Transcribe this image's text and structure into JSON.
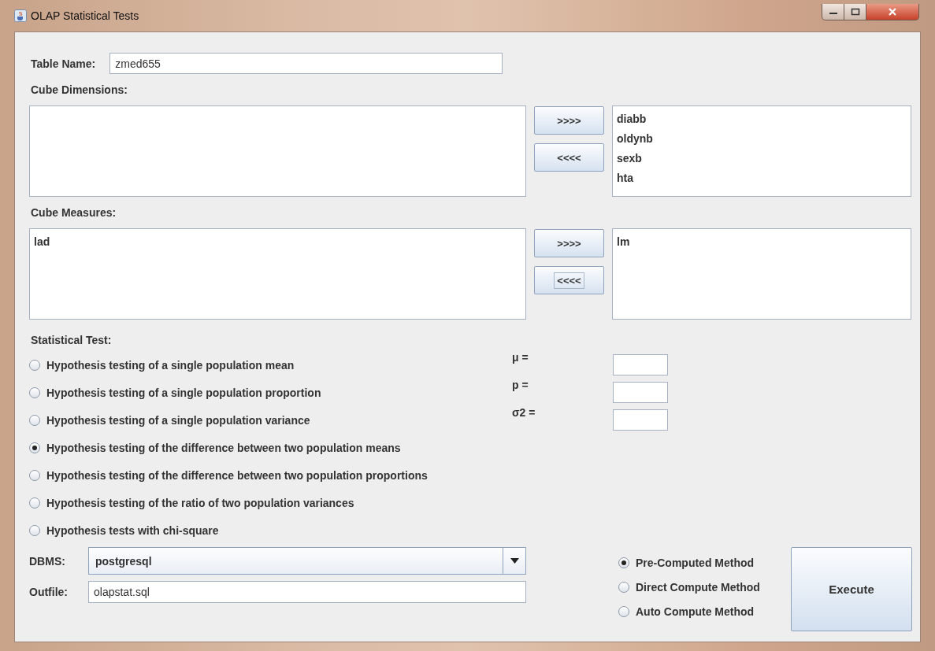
{
  "window": {
    "title": "OLAP Statistical Tests"
  },
  "table_name": {
    "label": "Table Name:",
    "value": "zmed655"
  },
  "cube_dimensions": {
    "label": "Cube Dimensions:",
    "buttons": [
      {
        "label": ">>>>",
        "focused": false
      },
      {
        "label": "<<<<",
        "focused": false
      }
    ],
    "chosen": [
      "diabb",
      "oldynb",
      "sexb",
      "hta"
    ]
  },
  "cube_measures": {
    "label": "Cube Measures:",
    "available": [
      "lad"
    ],
    "buttons": [
      {
        "label": ">>>>",
        "focused": false
      },
      {
        "label": "<<<<",
        "focused": true
      }
    ],
    "chosen": [
      "lm"
    ]
  },
  "statistical_test": {
    "label": "Statistical Test:",
    "options": [
      {
        "label": "Hypothesis testing of a single population mean",
        "selected": false
      },
      {
        "label": "Hypothesis testing of a single population proportion",
        "selected": false
      },
      {
        "label": "Hypothesis testing of a single population variance",
        "selected": false
      },
      {
        "label": "Hypothesis testing of the difference between two population means",
        "selected": true
      },
      {
        "label": "Hypothesis testing of the difference between two population proportions",
        "selected": false
      },
      {
        "label": "Hypothesis testing of the ratio of two population variances",
        "selected": false
      },
      {
        "label": "Hypothesis tests with chi-square",
        "selected": false
      }
    ],
    "parameters": [
      {
        "label": "μ ="
      },
      {
        "label": "p ="
      },
      {
        "label": "σ2 ="
      }
    ]
  },
  "dbms": {
    "label": "DBMS:",
    "value": "postgresql"
  },
  "outfile": {
    "label": "Outfile:",
    "value": "olapstat.sql"
  },
  "methods": [
    {
      "label": "Pre-Computed Method",
      "selected": true
    },
    {
      "label": "Direct Compute Method",
      "selected": false
    },
    {
      "label": "Auto Compute Method",
      "selected": false
    }
  ],
  "execute_button": "Execute"
}
